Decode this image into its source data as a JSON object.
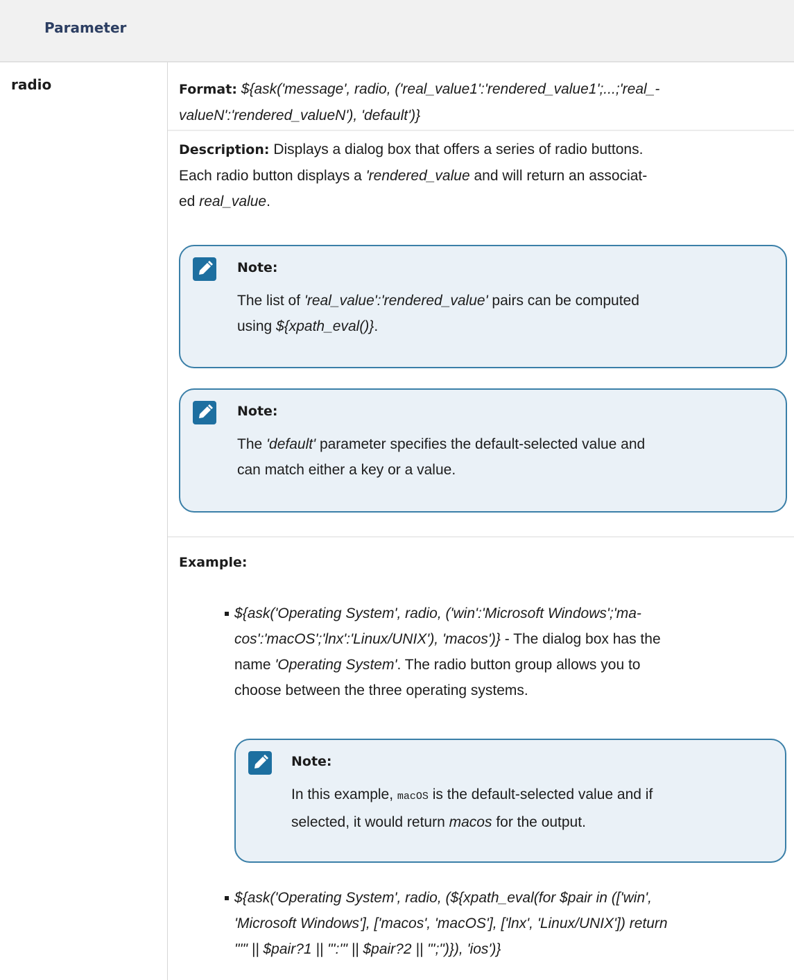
{
  "header": {
    "parameter_label": "Parameter"
  },
  "param": {
    "name": "radio"
  },
  "format": {
    "label": "Format:",
    "line1": "${ask('message', radio, ('real_value1':'rendered_value1';...;'real_-",
    "line2": "valueN':'rendered_valueN'), 'default')}"
  },
  "description": {
    "label": "Description:",
    "text1": " Displays a dialog box that offers a series of radio buttons.",
    "text2a": "Each radio button displays a ",
    "text2b": "'rendered_value",
    "text2c": " and will return an associat-",
    "text3a": "ed ",
    "text3b": "real_value",
    "text3c": "."
  },
  "note1": {
    "title": "Note:",
    "a": "The list of ",
    "b": "'real_value':'rendered_value'",
    "c": " pairs can be computed",
    "d": "using ",
    "e": "${xpath_eval()}",
    "f": "."
  },
  "note2": {
    "title": "Note:",
    "a": "The ",
    "b": "'default'",
    "c": " parameter specifies the default-selected value and",
    "d": "can match either a key or a value."
  },
  "example": {
    "label": "Example:",
    "item1": {
      "l1": "${ask('Operating System', radio, ('win':'Microsoft Windows';'ma-",
      "l2a": "cos':'macOS';'lnx':'Linux/UNIX'), 'macos')}",
      "l2b": " - The dialog box has the",
      "l3a": "name ",
      "l3b": "'Operating System'",
      "l3c": ". The radio button group allows you to",
      "l4": "choose between the three operating systems."
    },
    "note3": {
      "title": "Note:",
      "a": "In this example, ",
      "code": "macOS",
      "b": " is the default-selected value and if",
      "c": "selected, it would return ",
      "d": "macos",
      "e": " for the output."
    },
    "item2": {
      "l1": "${ask('Operating System', radio, (${xpath_eval(for $pair in (['win',",
      "l2": "'Microsoft Windows'], ['macos', 'macOS'], ['lnx', 'Linux/UNIX']) return",
      "l3": "\"'\" || $pair?1 || \"':'\" || $pair?2 || \"';\")}), 'ios')}"
    }
  },
  "icons": {
    "note": "note-pencil-icon"
  },
  "colors": {
    "note_bg": "#eaf1f7",
    "note_border": "#3a7fa8",
    "icon_bg": "#1d6fa0",
    "header_text": "#2c3e62"
  }
}
